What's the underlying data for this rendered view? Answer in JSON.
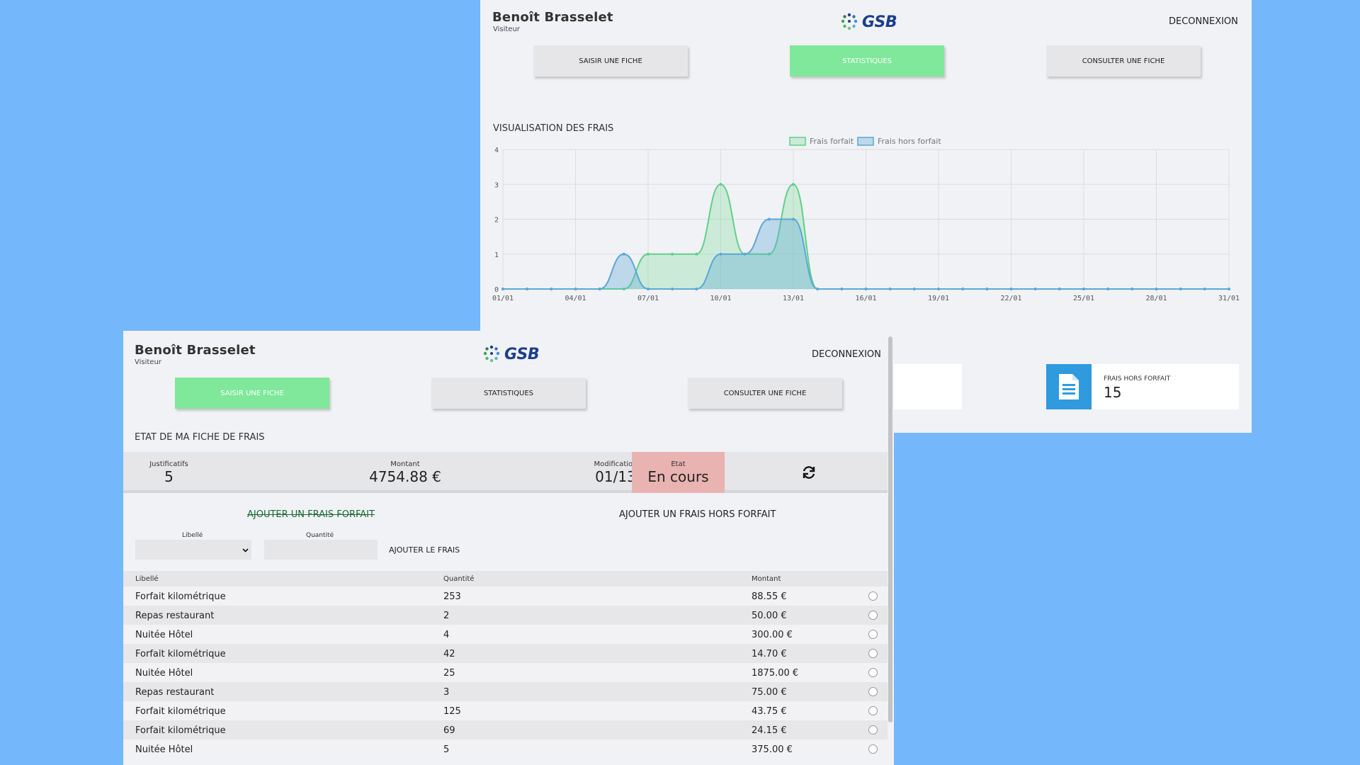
{
  "back_window": {
    "user": {
      "name": "Benoît Brasselet",
      "role": "Visiteur"
    },
    "logo_text": "GSB",
    "logout_label": "DECONNEXION",
    "nav": [
      {
        "label": "SAISIR UNE FICHE",
        "active": false
      },
      {
        "label": "STATISTIQUES",
        "active": true
      },
      {
        "label": "CONSULTER UNE FICHE",
        "active": false
      }
    ],
    "chart_section_title": "VISUALISATION DES FRAIS",
    "card": {
      "label": "FRAIS HORS FORFAIT",
      "value": "15",
      "icon": "document-icon",
      "icon_color": "#2f9ade"
    }
  },
  "chart_data": {
    "type": "area",
    "title": "",
    "xlabel": "",
    "ylabel": "",
    "x": [
      "01/01",
      "02/01",
      "03/01",
      "04/01",
      "05/01",
      "06/01",
      "07/01",
      "08/01",
      "09/01",
      "10/01",
      "11/01",
      "12/01",
      "13/01",
      "14/01",
      "15/01",
      "16/01",
      "17/01",
      "18/01",
      "19/01",
      "20/01",
      "21/01",
      "22/01",
      "23/01",
      "24/01",
      "25/01",
      "26/01",
      "27/01",
      "28/01",
      "29/01",
      "30/01",
      "31/01"
    ],
    "x_tick_labels": [
      "01/01",
      "04/01",
      "07/01",
      "10/01",
      "13/01",
      "16/01",
      "19/01",
      "22/01",
      "25/01",
      "28/01",
      "31/01"
    ],
    "ylim": [
      0,
      4
    ],
    "y_ticks": [
      "0",
      "1",
      "2",
      "3",
      "4"
    ],
    "grid": true,
    "legend_position": "top-center",
    "series": [
      {
        "name": "Frais forfait",
        "color": "#5fd08a",
        "values": [
          0,
          0,
          0,
          0,
          0,
          0,
          1,
          1,
          1,
          3,
          1,
          1,
          3,
          0,
          0,
          0,
          0,
          0,
          0,
          0,
          0,
          0,
          0,
          0,
          0,
          0,
          0,
          0,
          0,
          0,
          0
        ]
      },
      {
        "name": "Frais hors forfait",
        "color": "#5aa8d8",
        "values": [
          0,
          0,
          0,
          0,
          0,
          1,
          0,
          0,
          0,
          1,
          1,
          2,
          2,
          0,
          0,
          0,
          0,
          0,
          0,
          0,
          0,
          0,
          0,
          0,
          0,
          0,
          0,
          0,
          0,
          0,
          0
        ]
      }
    ]
  },
  "front_window": {
    "user": {
      "name": "Benoît Brasselet",
      "role": "Visiteur"
    },
    "logo_text": "GSB",
    "logout_label": "DECONNEXION",
    "nav": [
      {
        "label": "SAISIR UNE FICHE",
        "active": true
      },
      {
        "label": "STATISTIQUES",
        "active": false
      },
      {
        "label": "CONSULTER UNE FICHE",
        "active": false
      }
    ],
    "section_title": "ETAT DE MA FICHE DE FRAIS",
    "summary": {
      "justificatifs": {
        "label": "Justificatifs",
        "value": "5"
      },
      "montant": {
        "label": "Montant",
        "value": "4754.88 €"
      },
      "modification": {
        "label": "Modification",
        "value": "01/13"
      },
      "etat": {
        "label": "Etat",
        "value": "En cours",
        "color": "#e8b3b1"
      },
      "refresh_icon": "refresh-icon"
    },
    "form": {
      "tab_forfait": "AJOUTER UN FRAIS FORFAIT",
      "tab_hors_forfait": "AJOUTER UN FRAIS HORS FORFAIT",
      "libelle_label": "Libellé",
      "libelle_value": "",
      "quantite_label": "Quantité",
      "quantite_value": "",
      "add_label": "AJOUTER LE FRAIS"
    },
    "table": {
      "headers": [
        "Libellé",
        "Quantité",
        "Montant"
      ],
      "rows": [
        [
          "Forfait kilométrique",
          "253",
          "88.55 €"
        ],
        [
          "Repas restaurant",
          "2",
          "50.00 €"
        ],
        [
          "Nuitée Hôtel",
          "4",
          "300.00 €"
        ],
        [
          "Forfait kilométrique",
          "42",
          "14.70 €"
        ],
        [
          "Nuitée Hôtel",
          "25",
          "1875.00 €"
        ],
        [
          "Repas restaurant",
          "3",
          "75.00 €"
        ],
        [
          "Forfait kilométrique",
          "125",
          "43.75 €"
        ],
        [
          "Forfait kilométrique",
          "69",
          "24.15 €"
        ],
        [
          "Nuitée Hôtel",
          "5",
          "375.00 €"
        ]
      ]
    }
  },
  "colors": {
    "background": "#75b7fb",
    "active_button": "#7fe89a",
    "panel": "#f1f2f5",
    "button": "#e6e6e8"
  }
}
